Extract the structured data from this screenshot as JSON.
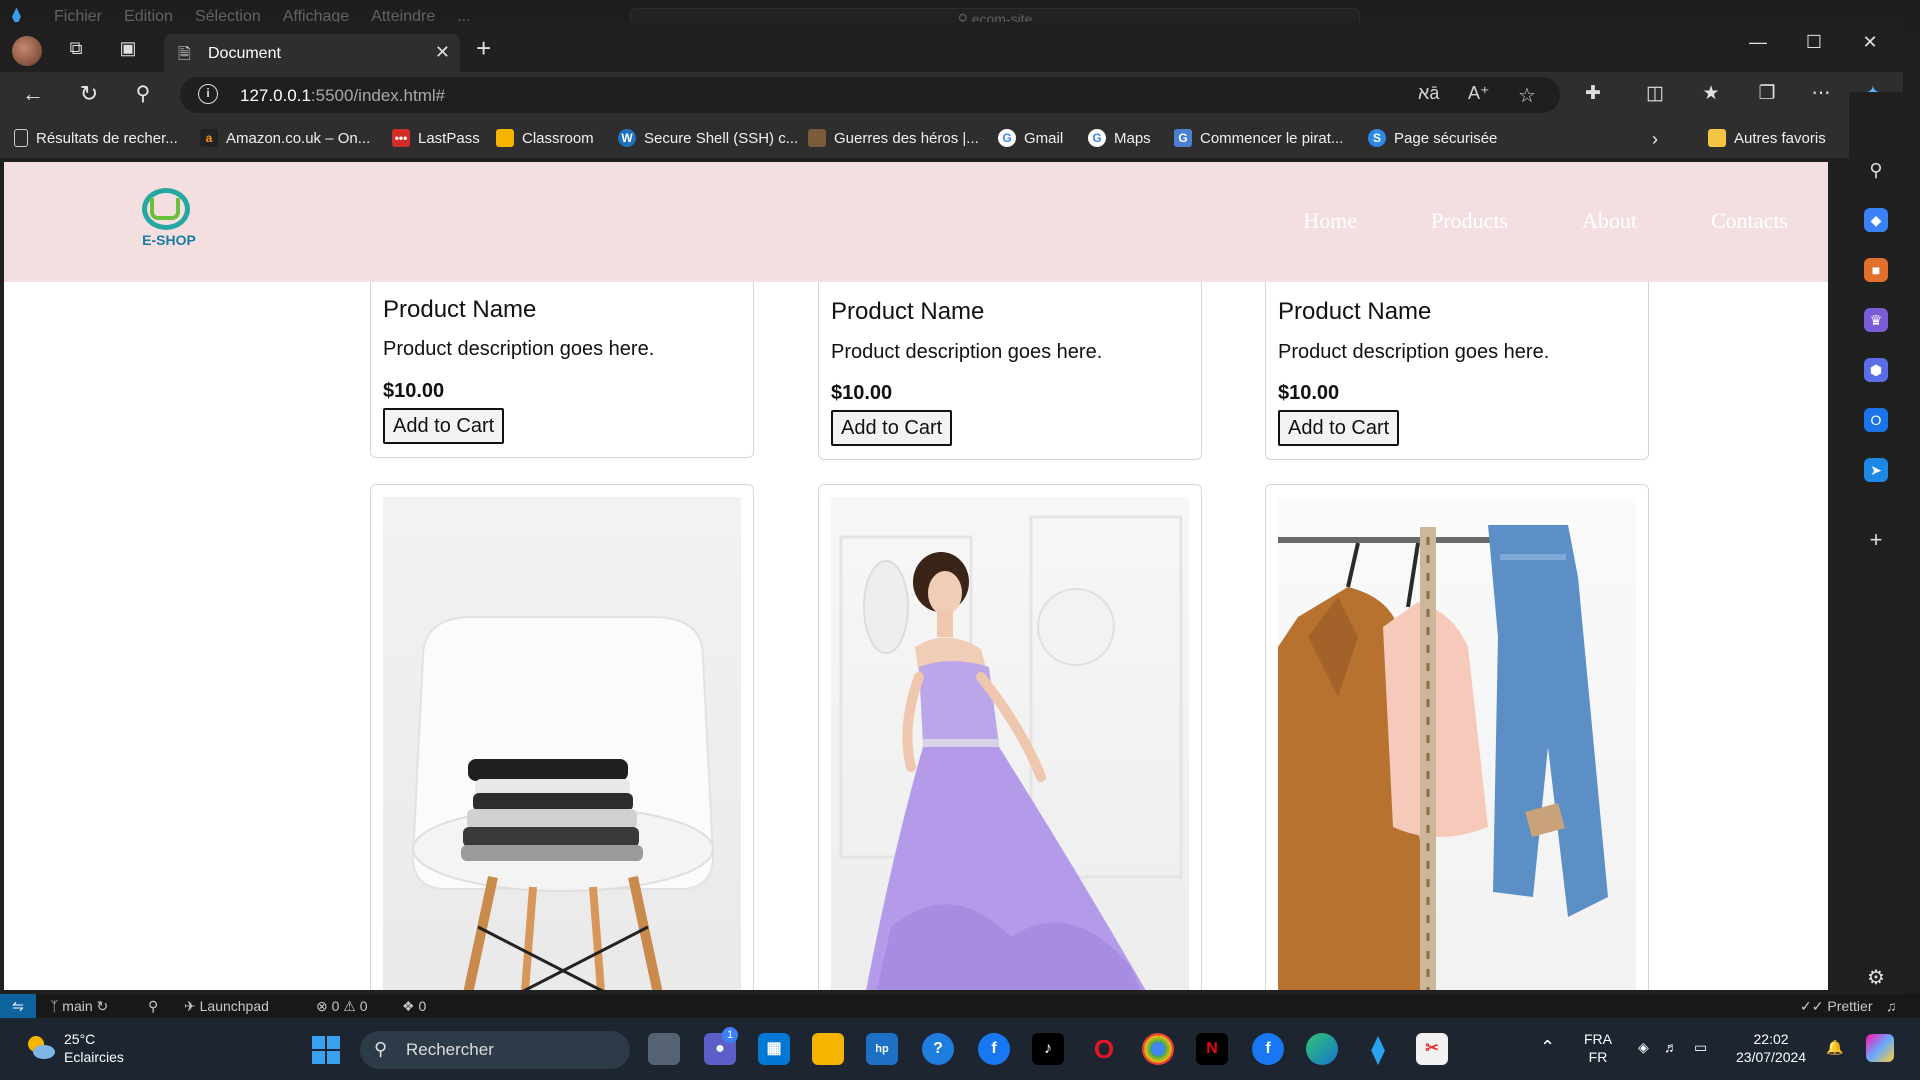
{
  "vscode": {
    "menu": [
      "Fichier",
      "Edition",
      "Sélection",
      "Affichage",
      "Atteindre",
      "..."
    ],
    "search_placeholder": "ecom-site"
  },
  "browser": {
    "tab_title": "Document",
    "url_host": "127.0.0.1",
    "url_rest": ":5500/index.html#",
    "bookmarks": [
      {
        "label": "Résultats de recher...",
        "icon": "page-icon",
        "color": "#9e9e9e"
      },
      {
        "label": "Amazon.co.uk – On...",
        "icon": "amazon-icon",
        "color": "#222222"
      },
      {
        "label": "LastPass",
        "icon": "lastpass-icon",
        "color": "#d32d27"
      },
      {
        "label": "Classroom",
        "icon": "classroom-icon",
        "color": "#f4b400"
      },
      {
        "label": "Secure Shell (SSH) c...",
        "icon": "wordpress-icon",
        "color": "#1e73be"
      },
      {
        "label": "Guerres des héros |...",
        "icon": "game-icon",
        "color": "#7a5b3a"
      },
      {
        "label": "Gmail",
        "icon": "google-icon",
        "color": "#ffffff"
      },
      {
        "label": "Maps",
        "icon": "google-icon",
        "color": "#ffffff"
      },
      {
        "label": "Commencer le pirat...",
        "icon": "translate-icon",
        "color": "#4a7fd4"
      },
      {
        "label": "Page sécurisée",
        "icon": "s-icon",
        "color": "#2b8be6"
      }
    ],
    "other_favorites": "Autres favoris"
  },
  "site": {
    "logo_text": "E-SHOP",
    "nav": [
      "Home",
      "Products",
      "About",
      "Contacts"
    ],
    "products_top": [
      {
        "name": "Product Name",
        "description": "Product description goes here.",
        "price": "$10.00",
        "button": "Add to Cart"
      },
      {
        "name": "Product Name",
        "description": "Product description goes here.",
        "price": "$10.00",
        "button": "Add to Cart"
      },
      {
        "name": "Product Name",
        "description": "Product description goes here.",
        "price": "$10.00",
        "button": "Add to Cart"
      }
    ]
  },
  "statusbar": {
    "branch": "main",
    "launchpad": "Launchpad",
    "errors": "0",
    "warnings": "0",
    "ports": "0",
    "prettier": "Prettier"
  },
  "taskbar": {
    "temperature": "25°C",
    "weather": "Eclaircies",
    "search_label": "Rechercher",
    "lang_top": "FRA",
    "lang_bottom": "FR",
    "time": "22:02",
    "date": "23/07/2024",
    "teams_badge": "1"
  }
}
